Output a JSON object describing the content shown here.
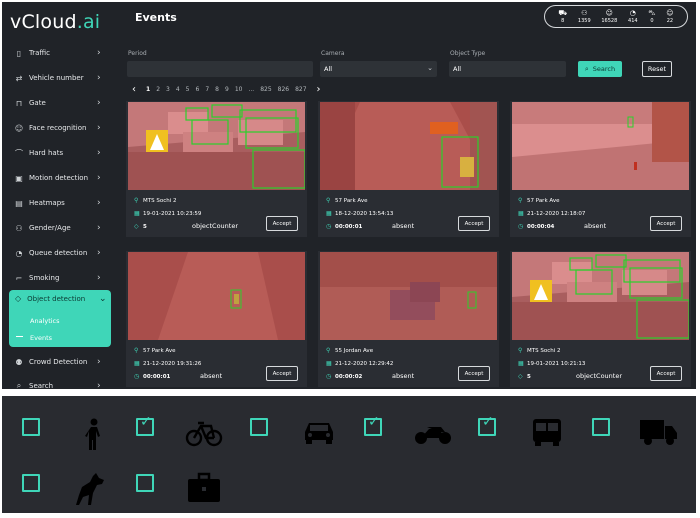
{
  "app": {
    "logo_text": "vCloud",
    "logo_suffix": ".ai",
    "page_title": "Events"
  },
  "stats": [
    {
      "icon": "sedan-icon",
      "value": "8"
    },
    {
      "icon": "people-icon",
      "value": "1359"
    },
    {
      "icon": "face-icon",
      "value": "16528"
    },
    {
      "icon": "queue-icon",
      "value": "414"
    },
    {
      "icon": "car-icon",
      "value": "0"
    },
    {
      "icon": "face-icon",
      "value": "22"
    }
  ],
  "sidebar": {
    "items": [
      {
        "label": "Traffic",
        "icon": "traffic-icon"
      },
      {
        "label": "Vehicle number",
        "icon": "vehicle-icon"
      },
      {
        "label": "Gate",
        "icon": "gate-icon"
      },
      {
        "label": "Face recognition",
        "icon": "face-icon"
      },
      {
        "label": "Hard hats",
        "icon": "hardhat-icon"
      },
      {
        "label": "Motion detection",
        "icon": "motion-icon"
      },
      {
        "label": "Heatmaps",
        "icon": "heatmap-icon"
      },
      {
        "label": "Gender/Age",
        "icon": "gender-icon"
      },
      {
        "label": "Queue detection",
        "icon": "queue-icon"
      },
      {
        "label": "Smoking",
        "icon": "smoking-icon"
      },
      {
        "label": "Crowd Detection",
        "icon": "crowd-icon"
      },
      {
        "label": "Search",
        "icon": "search-icon"
      }
    ],
    "active": {
      "label": "Object detection",
      "icon": "object-icon",
      "sub": [
        "Analytics",
        "Events"
      ]
    }
  },
  "filters": {
    "period_label": "Period",
    "period_value": "",
    "camera_label": "Camera",
    "camera_value": "All",
    "object_label": "Object Type",
    "object_value": "All",
    "search_label": "Search",
    "reset_label": "Reset"
  },
  "pagination": [
    "1",
    "2",
    "3",
    "4",
    "5",
    "6",
    "7",
    "8",
    "9",
    "10",
    "...",
    "825",
    "826",
    "827"
  ],
  "events": [
    {
      "location": "MTS Sochi 2",
      "date": "19-01-2021 10:23:59",
      "value": "5",
      "type": "objectCounter",
      "accept": "Accept",
      "scene": "street"
    },
    {
      "location": "57 Park Ave",
      "date": "18-12-2020 13:54:13",
      "value": "00:00:01",
      "type": "absent",
      "accept": "Accept",
      "scene": "corridor"
    },
    {
      "location": "57 Park Ave",
      "date": "21-12-2020 12:18:07",
      "value": "00:00:04",
      "type": "absent",
      "accept": "Accept",
      "scene": "snow"
    },
    {
      "location": "57 Park Ave",
      "date": "21-12-2020 19:31:26",
      "value": "00:00:01",
      "type": "absent",
      "accept": "Accept",
      "scene": "corridor2"
    },
    {
      "location": "55 Jordan Ave",
      "date": "21-12-2020 12:29:42",
      "value": "00:00:02",
      "type": "absent",
      "accept": "Accept",
      "scene": "yard"
    },
    {
      "location": "MTS Sochi 2",
      "date": "19-01-2021 10:21:13",
      "value": "5",
      "type": "objectCounter",
      "accept": "Accept",
      "scene": "street"
    }
  ],
  "object_types": [
    {
      "name": "person",
      "checked": false,
      "icon": "person-icon"
    },
    {
      "name": "bicycle",
      "checked": true,
      "icon": "bicycle-icon"
    },
    {
      "name": "car",
      "checked": false,
      "icon": "car-icon"
    },
    {
      "name": "motorcycle",
      "checked": true,
      "icon": "motorcycle-icon"
    },
    {
      "name": "bus",
      "checked": true,
      "icon": "bus-icon"
    },
    {
      "name": "truck",
      "checked": false,
      "icon": "truck-icon"
    },
    {
      "name": "dog",
      "checked": false,
      "icon": "dog-icon"
    },
    {
      "name": "suitcase",
      "checked": false,
      "icon": "suitcase-icon"
    }
  ]
}
